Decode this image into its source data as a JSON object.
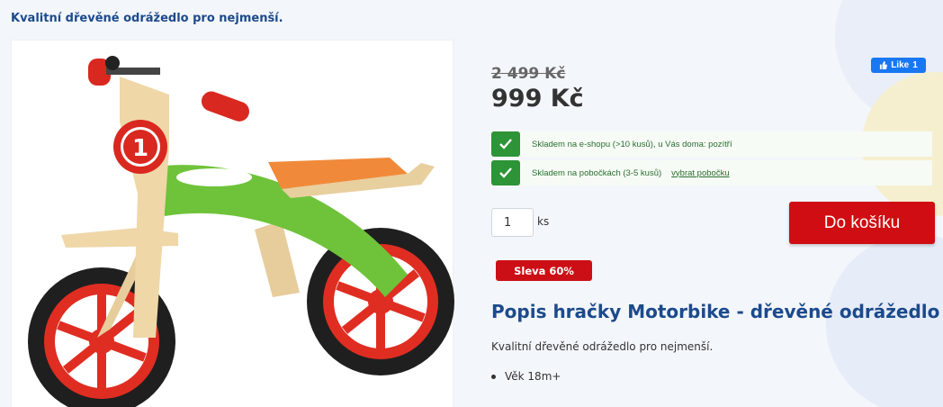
{
  "tagline": "Kvalitní dřevěné odrážedlo pro nejmenší.",
  "product_image": {
    "alt": "Motorbike dřevěné odrážedlo",
    "number_badge": "1"
  },
  "price": {
    "old": "2 499 Kč",
    "new": "999 Kč"
  },
  "facebook": {
    "label": "Like",
    "count": "1"
  },
  "stock": [
    {
      "text": "Skladem na e-shopu (>10 kusů), u Vás doma: pozítří",
      "link": ""
    },
    {
      "text": "Skladem na pobočkách (3-5 kusů)",
      "link": "vybrat pobočku"
    }
  ],
  "cart": {
    "quantity": "1",
    "unit": "ks",
    "button_label": "Do košíku"
  },
  "discount_badge": "Sleva 60%",
  "description": {
    "title": "Popis hračky Motorbike - dřevěné odrážedlo",
    "text": "Kvalitní dřevěné odrážedlo pro nejmenší.",
    "bullets": [
      "Věk 18m+"
    ]
  },
  "colors": {
    "brand_blue": "#1c4a8c",
    "cart_red": "#d00d12",
    "stock_green": "#2d9437",
    "facebook_blue": "#1877f2"
  }
}
